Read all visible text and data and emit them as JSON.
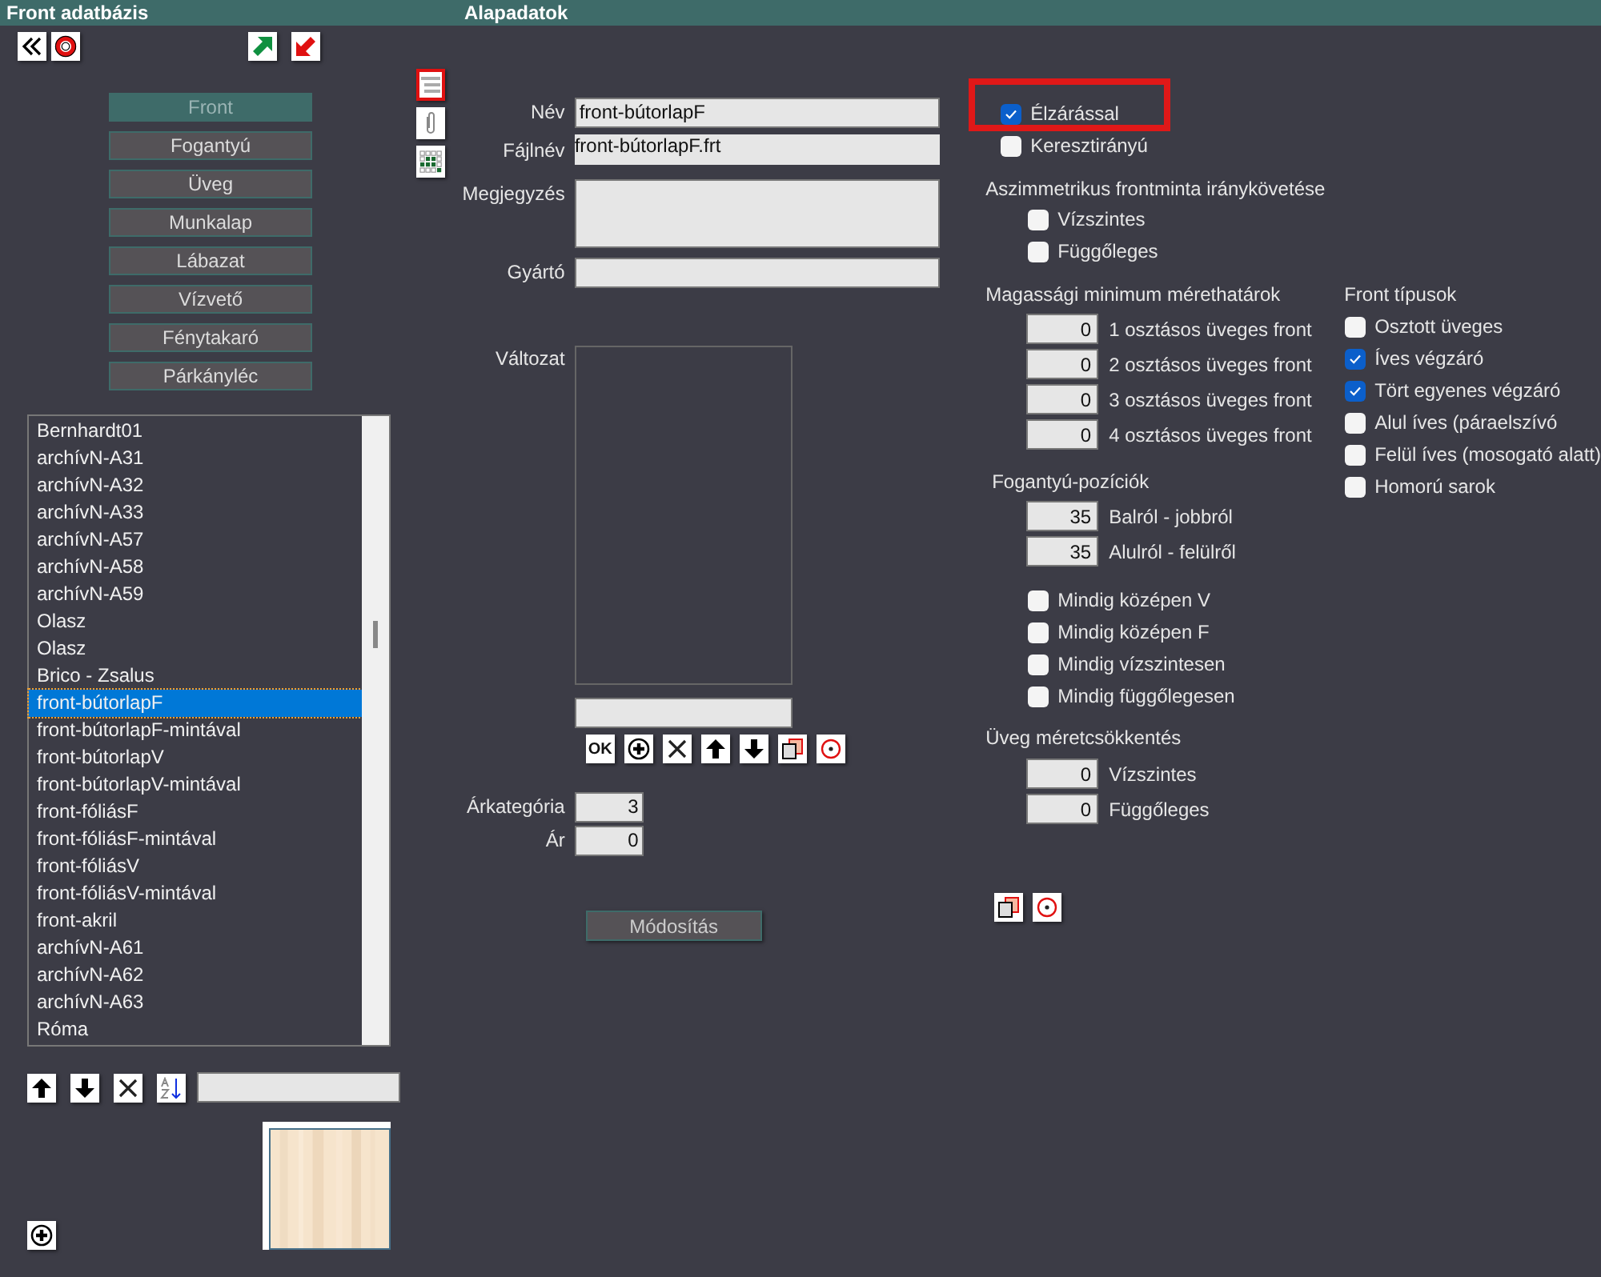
{
  "header": {
    "left_title": "Front adatbázis",
    "right_title": "Alapadatok"
  },
  "categories": [
    {
      "label": "Front",
      "selected": true
    },
    {
      "label": "Fogantyú",
      "selected": false
    },
    {
      "label": "Üveg",
      "selected": false
    },
    {
      "label": "Munkalap",
      "selected": false
    },
    {
      "label": "Lábazat",
      "selected": false
    },
    {
      "label": "Vízvető",
      "selected": false
    },
    {
      "label": "Fénytakaró",
      "selected": false
    },
    {
      "label": "Párkányléc",
      "selected": false
    }
  ],
  "list": {
    "items": [
      {
        "label": "Bernhardt01",
        "selected": false
      },
      {
        "label": "archívN-A31",
        "selected": false
      },
      {
        "label": "archívN-A32",
        "selected": false
      },
      {
        "label": "archívN-A33",
        "selected": false
      },
      {
        "label": "archívN-A57",
        "selected": false
      },
      {
        "label": "archívN-A58",
        "selected": false
      },
      {
        "label": "archívN-A59",
        "selected": false
      },
      {
        "label": "Olasz",
        "selected": false
      },
      {
        "label": "Olasz",
        "selected": false
      },
      {
        "label": "Brico - Zsalus",
        "selected": false
      },
      {
        "label": "front-bútorlapF",
        "selected": true
      },
      {
        "label": "front-bútorlapF-mintával",
        "selected": false
      },
      {
        "label": "front-bútorlapV",
        "selected": false
      },
      {
        "label": "front-bútorlapV-mintával",
        "selected": false
      },
      {
        "label": "front-fóliásF",
        "selected": false
      },
      {
        "label": "front-fóliásF-mintával",
        "selected": false
      },
      {
        "label": "front-fóliásV",
        "selected": false
      },
      {
        "label": "front-fóliásV-mintával",
        "selected": false
      },
      {
        "label": "front-akril",
        "selected": false
      },
      {
        "label": "archívN-A61",
        "selected": false
      },
      {
        "label": "archívN-A62",
        "selected": false
      },
      {
        "label": "archívN-A63",
        "selected": false
      },
      {
        "label": "Róma",
        "selected": false
      }
    ]
  },
  "form": {
    "fields": [
      {
        "label": "Név",
        "value": "front-bútorlapF",
        "kind": "line"
      },
      {
        "label": "Fájlnév",
        "value": "front-bútorlapF.frt",
        "kind": "plain"
      },
      {
        "label": "Megjegyzés",
        "kind": "area"
      },
      {
        "label": "Gyártó",
        "kind": "line"
      }
    ],
    "variant_label": "Változat",
    "ok_label": "OK",
    "category_label": "Árkategória",
    "category_value": "3",
    "price_label": "Ár",
    "price_value": "0",
    "modify_button": "Módosítás"
  },
  "edge_options": [
    {
      "label": "Élzárással",
      "checked": true,
      "highlighted": true
    },
    {
      "label": "Keresztirányú",
      "checked": false,
      "highlighted": false
    }
  ],
  "asymmetric": {
    "title": "Aszimmetrikus frontminta iránykövetése",
    "options": [
      {
        "label": "Vízszintes",
        "checked": false
      },
      {
        "label": "Függőleges",
        "checked": false
      }
    ]
  },
  "height_limits": {
    "title": "Magassági minimum mérethatárok",
    "rows": [
      {
        "value": "0",
        "label": "1 osztásos üveges front"
      },
      {
        "value": "0",
        "label": "2 osztásos üveges front"
      },
      {
        "value": "0",
        "label": "3 osztásos üveges front"
      },
      {
        "value": "0",
        "label": "4 osztásos üveges front"
      }
    ]
  },
  "handle_positions": {
    "title": "Fogantyú-pozíciók",
    "rows": [
      {
        "value": "35",
        "label": "Balról - jobbról"
      },
      {
        "value": "35",
        "label": "Alulról - felülről"
      }
    ],
    "options": [
      {
        "label": "Mindig középen V",
        "checked": false
      },
      {
        "label": "Mindig középen F",
        "checked": false
      },
      {
        "label": "Mindig vízszintesen",
        "checked": false
      },
      {
        "label": "Mindig függőlegesen",
        "checked": false
      }
    ]
  },
  "glass_reduction": {
    "title": "Üveg méretcsökkentés",
    "rows": [
      {
        "value": "0",
        "label": "Vízszintes"
      },
      {
        "value": "0",
        "label": "Függőleges"
      }
    ]
  },
  "front_types": {
    "title": "Front típusok",
    "options": [
      {
        "label": "Osztott üveges",
        "checked": false
      },
      {
        "label": "Íves végzáró",
        "checked": true
      },
      {
        "label": "Tört egyenes végzáró",
        "checked": true
      },
      {
        "label": "Alul íves (páraelszívó",
        "checked": false
      },
      {
        "label": "Felül íves (mosogató alatt)",
        "checked": false
      },
      {
        "label": "Homorú sarok",
        "checked": false
      }
    ]
  }
}
